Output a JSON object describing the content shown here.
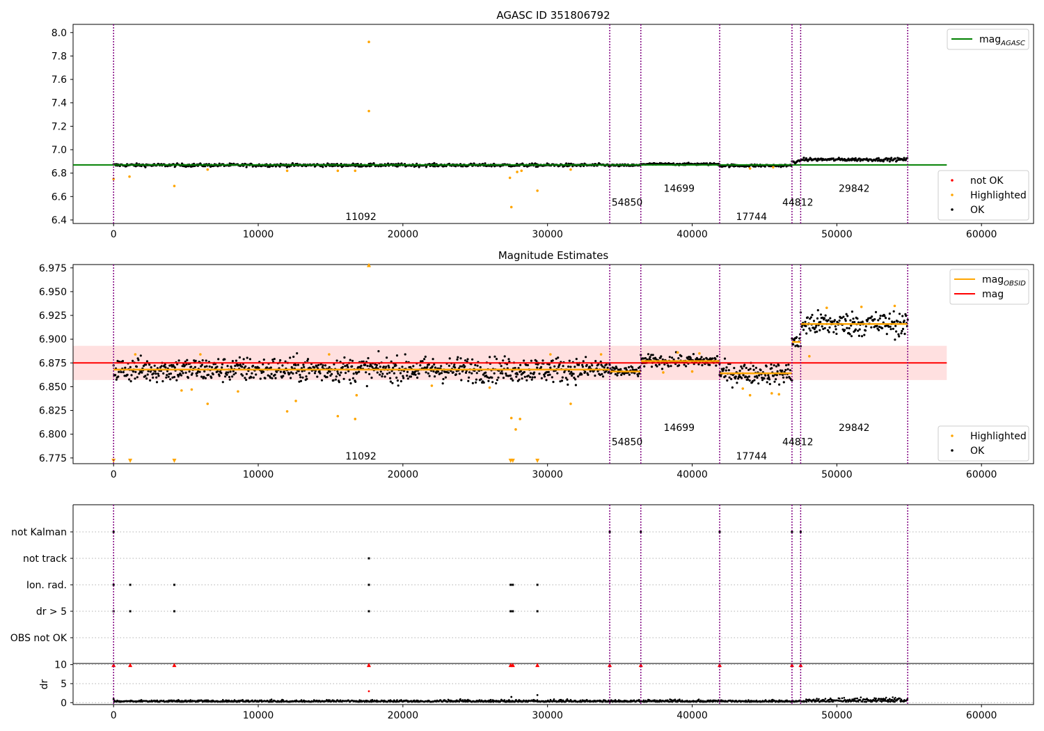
{
  "chart_data": [
    {
      "type": "scatter",
      "title": "AGASC ID 351806792",
      "xlabel": "",
      "ylabel": "",
      "xlim": [
        -2800,
        63600
      ],
      "ylim": [
        6.37,
        8.07
      ],
      "x_ticks": [
        0,
        10000,
        20000,
        30000,
        40000,
        50000,
        60000
      ],
      "x_tick_labels": [
        "0",
        "10000",
        "20000",
        "30000",
        "40000",
        "50000",
        "60000"
      ],
      "y_ticks": [
        6.4,
        6.6,
        6.8,
        7.0,
        7.2,
        7.4,
        7.6,
        7.8,
        8.0
      ],
      "y_tick_labels": [
        "6.4",
        "6.6",
        "6.8",
        "7.0",
        "7.2",
        "7.4",
        "7.6",
        "7.8",
        "8.0"
      ],
      "legend_top": {
        "placement": "upper right",
        "entries": [
          {
            "label": "mag",
            "subscript": "AGASC",
            "color": "#008000",
            "marker": "line"
          }
        ]
      },
      "legend_bottom": {
        "placement": "lower right",
        "entries": [
          {
            "label": "not OK",
            "color": "#ff0000",
            "marker": "dot"
          },
          {
            "label": "Highlighted",
            "color": "#ffa500",
            "marker": "dot"
          },
          {
            "label": "OK",
            "color": "#000000",
            "marker": "dot"
          }
        ]
      },
      "mag_agasc": 6.87,
      "mag_agasc_xrange": [
        -2800,
        57600
      ],
      "obsid_boundaries": [
        0,
        34300,
        36450,
        41900,
        46900,
        47500,
        54900
      ],
      "obsid_labels": [
        {
          "text": "11092",
          "x": 17100,
          "y": 6.43
        },
        {
          "text": "54850",
          "x": 35500,
          "y": 6.55
        },
        {
          "text": "14699",
          "x": 39100,
          "y": 6.67
        },
        {
          "text": "17744",
          "x": 44100,
          "y": 6.43
        },
        {
          "text": "44812",
          "x": 47300,
          "y": 6.55
        },
        {
          "text": "29842",
          "x": 51200,
          "y": 6.67
        }
      ],
      "ok_bands": [
        {
          "x": [
            0,
            34300
          ],
          "y": 6.868,
          "spread": 0.012
        },
        {
          "x": [
            34300,
            36450
          ],
          "y": 6.866,
          "spread": 0.008
        },
        {
          "x": [
            36450,
            41900
          ],
          "y": 6.877,
          "spread": 0.008
        },
        {
          "x": [
            41900,
            46900
          ],
          "y": 6.864,
          "spread": 0.01
        },
        {
          "x": [
            46900,
            47500
          ],
          "y": 6.897,
          "spread": 0.01
        },
        {
          "x": [
            47500,
            54900
          ],
          "y": 6.916,
          "spread": 0.012
        }
      ],
      "highlighted_points": [
        {
          "x": 17650,
          "y": 7.92
        },
        {
          "x": 17650,
          "y": 7.33
        },
        {
          "x": 29300,
          "y": 6.65
        },
        {
          "x": 27500,
          "y": 6.51
        },
        {
          "x": 4200,
          "y": 6.69
        },
        {
          "x": 0,
          "y": 6.75
        },
        {
          "x": 1100,
          "y": 6.77
        },
        {
          "x": 27400,
          "y": 6.76
        },
        {
          "x": 27900,
          "y": 6.81
        },
        {
          "x": 28200,
          "y": 6.82
        },
        {
          "x": 16700,
          "y": 6.82
        },
        {
          "x": 15500,
          "y": 6.82
        },
        {
          "x": 12000,
          "y": 6.82
        },
        {
          "x": 6500,
          "y": 6.83
        },
        {
          "x": 31600,
          "y": 6.83
        },
        {
          "x": 44000,
          "y": 6.84
        },
        {
          "x": 45600,
          "y": 6.85
        }
      ]
    },
    {
      "type": "scatter",
      "title": "Magnitude Estimates",
      "xlabel": "",
      "ylabel": "",
      "xlim": [
        -2800,
        63600
      ],
      "ylim": [
        6.769,
        6.9785
      ],
      "x_ticks": [
        0,
        10000,
        20000,
        30000,
        40000,
        50000,
        60000
      ],
      "x_tick_labels": [
        "0",
        "10000",
        "20000",
        "30000",
        "40000",
        "50000",
        "60000"
      ],
      "y_ticks": [
        6.775,
        6.8,
        6.825,
        6.85,
        6.875,
        6.9,
        6.925,
        6.95,
        6.975
      ],
      "y_tick_labels": [
        "6.775",
        "6.800",
        "6.825",
        "6.850",
        "6.875",
        "6.900",
        "6.925",
        "6.950",
        "6.975"
      ],
      "legend_top": {
        "placement": "upper right",
        "entries": [
          {
            "label": "mag",
            "subscript": "OBSID",
            "color": "#ffa500",
            "marker": "line"
          },
          {
            "label": "mag",
            "subscript": "",
            "color": "#ff0000",
            "marker": "line"
          }
        ]
      },
      "legend_bottom": {
        "placement": "lower right",
        "entries": [
          {
            "label": "Highlighted",
            "color": "#ffa500",
            "marker": "dot"
          },
          {
            "label": "OK",
            "color": "#000000",
            "marker": "dot"
          }
        ]
      },
      "mag": 6.875,
      "mag_band": [
        6.857,
        6.893
      ],
      "mag_xrange": [
        -2800,
        57600
      ],
      "mag_obsid": [
        {
          "x": [
            0,
            34300
          ],
          "y": 6.868
        },
        {
          "x": [
            34300,
            36450
          ],
          "y": 6.866
        },
        {
          "x": [
            36450,
            41900
          ],
          "y": 6.877
        },
        {
          "x": [
            41900,
            46900
          ],
          "y": 6.864
        },
        {
          "x": [
            46900,
            47500
          ],
          "y": 6.897
        },
        {
          "x": [
            47500,
            54900
          ],
          "y": 6.916
        }
      ],
      "obsid_boundaries": [
        0,
        34300,
        36450,
        41900,
        46900,
        47500,
        54900
      ],
      "obsid_labels": [
        {
          "text": "11092",
          "x": 17100,
          "y": 6.777
        },
        {
          "text": "54850",
          "x": 35500,
          "y": 6.792
        },
        {
          "text": "14699",
          "x": 39100,
          "y": 6.807
        },
        {
          "text": "17744",
          "x": 44100,
          "y": 6.777
        },
        {
          "text": "44812",
          "x": 47300,
          "y": 6.792
        },
        {
          "text": "29842",
          "x": 51200,
          "y": 6.807
        }
      ],
      "ok_bands": [
        {
          "x": [
            0,
            34300
          ],
          "y": 6.868,
          "spread": 0.012
        },
        {
          "x": [
            34300,
            36450
          ],
          "y": 6.866,
          "spread": 0.005
        },
        {
          "x": [
            36450,
            41900
          ],
          "y": 6.877,
          "spread": 0.006
        },
        {
          "x": [
            41900,
            46900
          ],
          "y": 6.864,
          "spread": 0.01
        },
        {
          "x": [
            46900,
            47500
          ],
          "y": 6.897,
          "spread": 0.01
        },
        {
          "x": [
            47500,
            54900
          ],
          "y": 6.916,
          "spread": 0.012
        }
      ],
      "highlighted_points": [
        {
          "x": 12000,
          "y": 6.824
        },
        {
          "x": 12600,
          "y": 6.835
        },
        {
          "x": 6500,
          "y": 6.832
        },
        {
          "x": 15500,
          "y": 6.819
        },
        {
          "x": 16700,
          "y": 6.816
        },
        {
          "x": 16800,
          "y": 6.841
        },
        {
          "x": 27500,
          "y": 6.817
        },
        {
          "x": 28100,
          "y": 6.816
        },
        {
          "x": 27800,
          "y": 6.805
        },
        {
          "x": 31600,
          "y": 6.832
        },
        {
          "x": 8600,
          "y": 6.845
        },
        {
          "x": 4700,
          "y": 6.846
        },
        {
          "x": 5400,
          "y": 6.847
        },
        {
          "x": 44000,
          "y": 6.841
        },
        {
          "x": 45500,
          "y": 6.843
        },
        {
          "x": 46000,
          "y": 6.842
        },
        {
          "x": 43500,
          "y": 6.848
        },
        {
          "x": 48100,
          "y": 6.882
        },
        {
          "x": 39000,
          "y": 6.886
        },
        {
          "x": 40500,
          "y": 6.885
        },
        {
          "x": 1500,
          "y": 6.884
        },
        {
          "x": 6000,
          "y": 6.884
        },
        {
          "x": 14900,
          "y": 6.884
        },
        {
          "x": 30200,
          "y": 6.884
        },
        {
          "x": 33700,
          "y": 6.884
        },
        {
          "x": 22000,
          "y": 6.851
        },
        {
          "x": 26000,
          "y": 6.849
        },
        {
          "x": 38000,
          "y": 6.865
        },
        {
          "x": 40000,
          "y": 6.866
        },
        {
          "x": 51700,
          "y": 6.934
        },
        {
          "x": 54000,
          "y": 6.935
        },
        {
          "x": 49300,
          "y": 6.933
        }
      ],
      "clipped_points": [
        {
          "x": 17650,
          "y": 6.978
        },
        {
          "x": 0,
          "y": 6.772
        },
        {
          "x": 1150,
          "y": 6.772
        },
        {
          "x": 4200,
          "y": 6.772
        },
        {
          "x": 27450,
          "y": 6.772
        },
        {
          "x": 27600,
          "y": 6.772
        },
        {
          "x": 29300,
          "y": 6.772
        }
      ]
    },
    {
      "type": "scatter",
      "title": "",
      "xlabel": "",
      "ylabel": "",
      "xlim": [
        -2800,
        63600
      ],
      "categories": [
        "not Kalman",
        "not track",
        "Ion. rad.",
        "dr > 5",
        "OBS not OK"
      ],
      "obsid_boundaries": [
        0,
        34300,
        36450,
        41900,
        46900,
        47500,
        54900
      ],
      "flags": {
        "not Kalman": [
          0,
          34300,
          36450,
          41900,
          46900,
          47500
        ],
        "not track": [
          17650
        ],
        "Ion. rad.": [
          0,
          1150,
          4200,
          17650,
          27450,
          27600,
          29300
        ],
        "dr > 5": [
          0,
          1150,
          4200,
          17650,
          27450,
          27600,
          29300
        ],
        "OBS not OK": []
      }
    },
    {
      "type": "scatter",
      "title": "",
      "xlabel": "",
      "ylabel": "dr",
      "xlim": [
        -2800,
        63600
      ],
      "ylim": [
        -0.5,
        10.3
      ],
      "x_ticks": [
        0,
        10000,
        20000,
        30000,
        40000,
        50000,
        60000
      ],
      "x_tick_labels": [
        "0",
        "10000",
        "20000",
        "30000",
        "40000",
        "50000",
        "60000"
      ],
      "y_ticks": [
        0,
        5,
        10
      ],
      "y_tick_labels": [
        "0",
        "5",
        "10"
      ],
      "obsid_boundaries": [
        0,
        34300,
        36450,
        41900,
        46900,
        47500,
        54900
      ],
      "clipped_points_not_ok": [
        0,
        1150,
        4200,
        17650,
        27450,
        27600,
        29300,
        34300,
        36450,
        41900,
        46900,
        47500
      ],
      "outlier_points": [
        {
          "x": 17650,
          "y": 3.0,
          "color": "#ff0000"
        },
        {
          "x": 29300,
          "y": 2.0,
          "color": "#000000"
        },
        {
          "x": 27500,
          "y": 1.5,
          "color": "#000000"
        },
        {
          "x": 0,
          "y": 1.0,
          "color": "#000000"
        }
      ],
      "baseline": {
        "x": [
          0,
          54900
        ],
        "y": 0.2,
        "spread": 0.3
      }
    }
  ]
}
